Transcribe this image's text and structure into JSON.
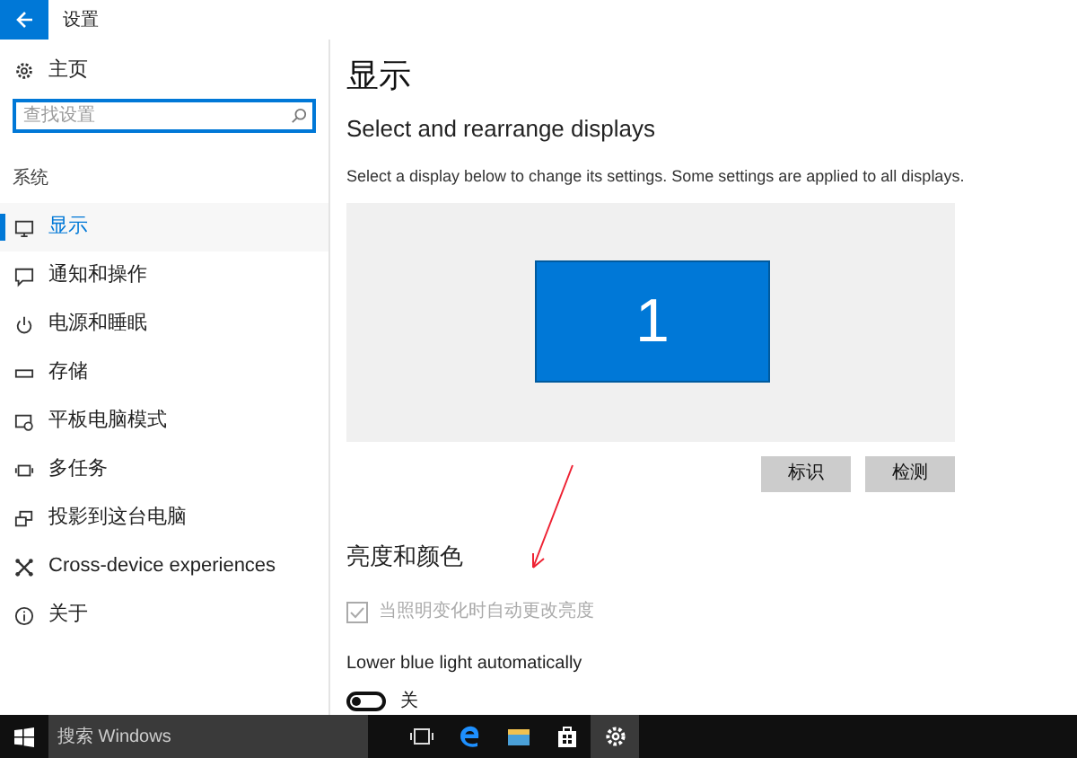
{
  "window": {
    "title": "设置"
  },
  "sidebar": {
    "home": "主页",
    "search": {
      "placeholder": "查找设置"
    },
    "section": "系统",
    "items": [
      {
        "label": "显示",
        "kind": "monitor",
        "selected": true
      },
      {
        "label": "通知和操作",
        "kind": "message",
        "selected": false
      },
      {
        "label": "电源和睡眠",
        "kind": "power",
        "selected": false
      },
      {
        "label": "存储",
        "kind": "storage",
        "selected": false
      },
      {
        "label": "平板电脑模式",
        "kind": "tablet",
        "selected": false
      },
      {
        "label": "多任务",
        "kind": "multitask",
        "selected": false
      },
      {
        "label": "投影到这台电脑",
        "kind": "project",
        "selected": false
      },
      {
        "label": "Cross-device experiences",
        "kind": "cross",
        "selected": false
      },
      {
        "label": "关于",
        "kind": "info",
        "selected": false
      }
    ]
  },
  "content": {
    "title": "显示",
    "subtitle": "Select and rearrange displays",
    "description": "Select a display below to change its settings. Some settings are applied to all displays.",
    "displays": [
      {
        "label": "1",
        "selected": true
      }
    ],
    "buttons": [
      "标识",
      "检测"
    ],
    "section": "亮度和颜色",
    "auto_brightness": {
      "label": "当照明变化时自动更改亮度",
      "checked": true,
      "disabled": true
    },
    "blue_light": {
      "label": "Lower blue light automatically",
      "on": false,
      "state": "关"
    }
  },
  "taskbar": {
    "search": "搜索 Windows",
    "apps": [
      {
        "kind": "taskview",
        "selected": false
      },
      {
        "kind": "edge",
        "selected": false
      },
      {
        "kind": "explorer",
        "selected": false
      },
      {
        "kind": "store",
        "selected": false
      },
      {
        "kind": "settings",
        "selected": true
      }
    ]
  }
}
